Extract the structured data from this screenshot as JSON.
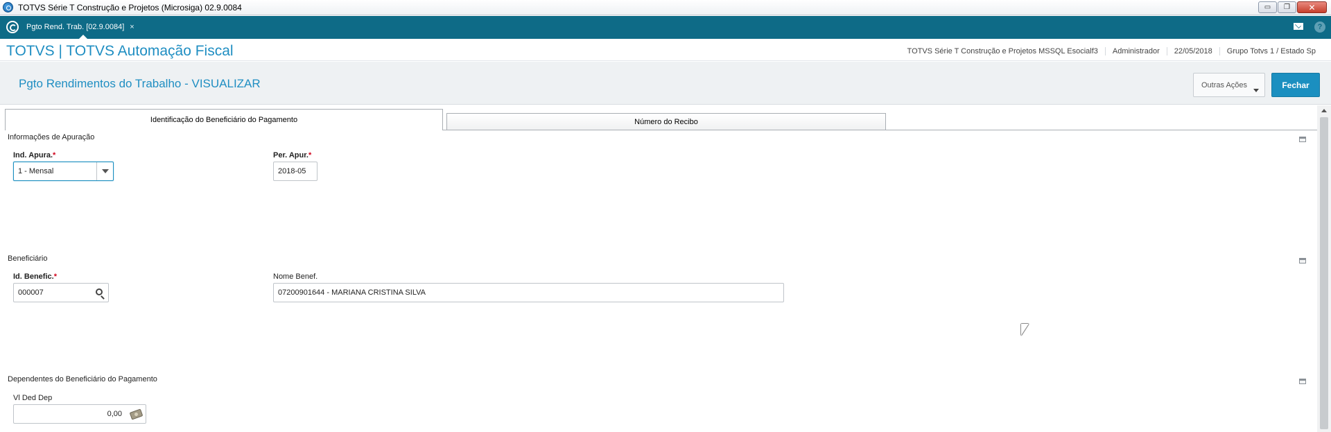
{
  "window": {
    "title": "TOTVS Série T Construção e Projetos (Microsiga) 02.9.0084",
    "minimize": "▭",
    "restore": "❐",
    "close": "✕"
  },
  "tabbar": {
    "program_tab": "Pgto Rend. Trab. [02.9.0084]",
    "tab_close": "×",
    "help": "?"
  },
  "header": {
    "brand": "TOTVS | TOTVS Automação Fiscal",
    "environment": "TOTVS Série T Construção e Projetos MSSQL Esocialf3",
    "user": "Administrador",
    "date": "22/05/2018",
    "company": "Grupo Totvs 1 / Estado Sp"
  },
  "page": {
    "title": "Pgto Rendimentos do Trabalho - VISUALIZAR",
    "outras_acoes": "Outras Ações",
    "fechar": "Fechar"
  },
  "folders": {
    "tab1": "Identificação do Beneficiário do Pagamento",
    "tab2": "Número do Recibo"
  },
  "sections": {
    "apuracao": {
      "title": "Informações de Apuração",
      "ind_apura_label": "Ind. Apura.",
      "ind_apura_value": "1 - Mensal",
      "per_apur_label": "Per. Apur.",
      "per_apur_value": "2018-05"
    },
    "beneficiario": {
      "title": "Beneficiário",
      "id_benefic_label": "Id. Benefic.",
      "id_benefic_value": "000007",
      "nome_benef_label": "Nome Benef.",
      "nome_benef_value": "07200901644 - MARIANA CRISTINA SILVA"
    },
    "dependentes": {
      "title": "Dependentes do Beneficiário do Pagamento",
      "vl_ded_dep_label": "Vl Ded Dep",
      "vl_ded_dep_value": "0,00"
    }
  },
  "required_mark": "*",
  "colors": {
    "tabbar": "#0e6b87",
    "brand": "#1f8ec2",
    "primary_button": "#1b8fc0"
  }
}
